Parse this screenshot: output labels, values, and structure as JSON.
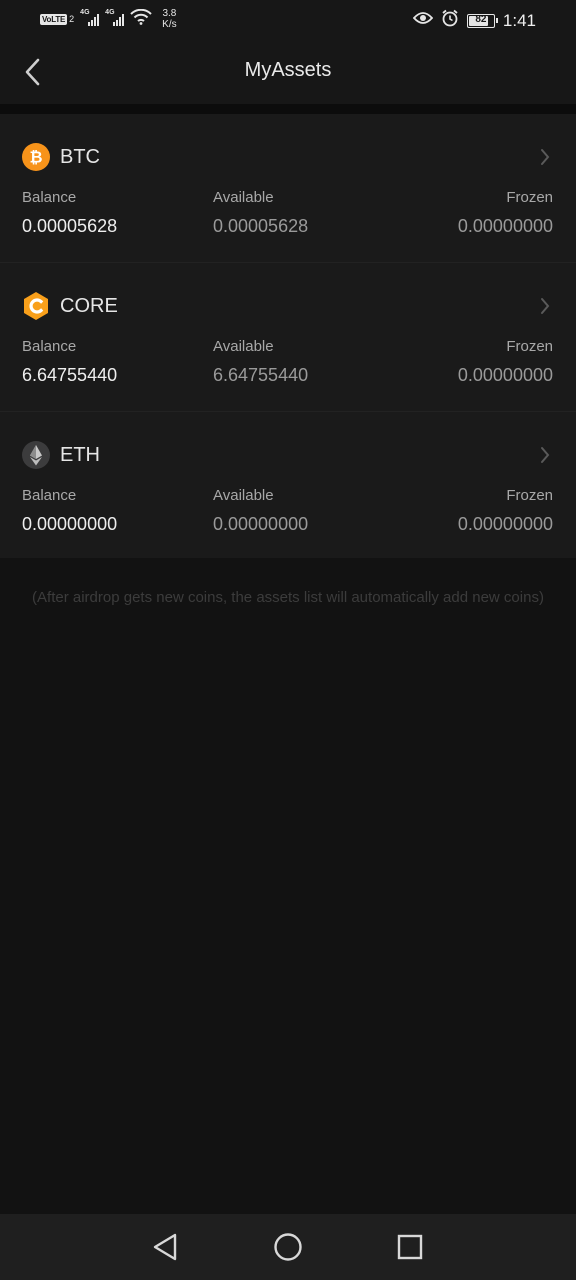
{
  "status_bar": {
    "volte": "VoLTE",
    "sim": "2",
    "net1": "4G",
    "net2": "4G",
    "speed_value": "3.8",
    "speed_unit": "K/s",
    "battery": "82",
    "battery_level": 0.82,
    "time": "1:41"
  },
  "header": {
    "title": "MyAssets"
  },
  "assets": [
    {
      "symbol": "BTC",
      "icon": "bitcoin-icon",
      "color": "#F7931A",
      "balance_label": "Balance",
      "available_label": "Available",
      "frozen_label": "Frozen",
      "balance": "0.00005628",
      "available": "0.00005628",
      "frozen": "0.00000000"
    },
    {
      "symbol": "CORE",
      "icon": "core-icon",
      "color": "#F9A01B",
      "balance_label": "Balance",
      "available_label": "Available",
      "frozen_label": "Frozen",
      "balance": "6.64755440",
      "available": "6.64755440",
      "frozen": "0.00000000"
    },
    {
      "symbol": "ETH",
      "icon": "ethereum-icon",
      "color": "#3C3C3D",
      "balance_label": "Balance",
      "available_label": "Available",
      "frozen_label": "Frozen",
      "balance": "0.00000000",
      "available": "0.00000000",
      "frozen": "0.00000000"
    }
  ],
  "note": "(After airdrop gets new coins, the assets list will automatically add new coins)",
  "nav": {
    "back": "triangle-back-icon",
    "home": "circle-home-icon",
    "recents": "square-recents-icon"
  }
}
